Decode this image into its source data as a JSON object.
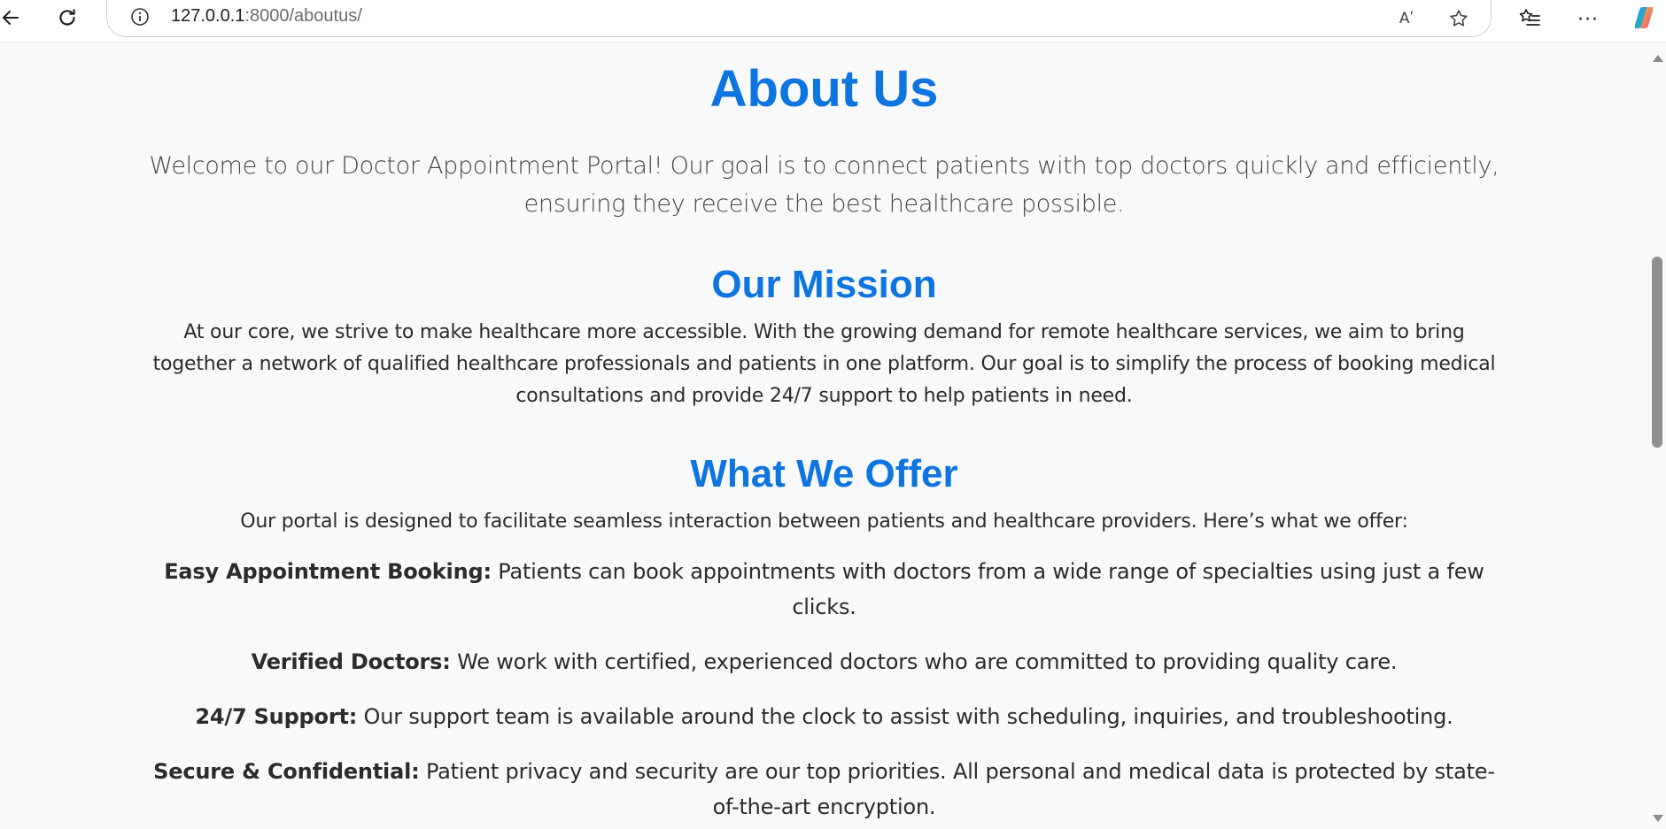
{
  "browser": {
    "url_host": "127.0.0.1",
    "url_rest": ":8000/aboutus/",
    "read_aloud_label": "Aʹ",
    "more_label": "···"
  },
  "page": {
    "title": "About Us",
    "lead": "Welcome to our Doctor Appointment Portal! Our goal is to connect patients with top doctors quickly and efficiently, ensuring they receive the best healthcare possible.",
    "mission": {
      "heading": "Our Mission",
      "text": "At our core, we strive to make healthcare more accessible. With the growing demand for remote healthcare services, we aim to bring together a network of qualified healthcare professionals and patients in one platform. Our goal is to simplify the process of booking medical consultations and provide 24/7 support to help patients in need."
    },
    "offer": {
      "heading": "What We Offer",
      "intro": "Our portal is designed to facilitate seamless interaction between patients and healthcare providers. Here’s what we offer:",
      "features": [
        {
          "label": "Easy Appointment Booking:",
          "text": " Patients can book appointments with doctors from a wide range of specialties using just a few clicks."
        },
        {
          "label": "Verified Doctors:",
          "text": " We work with certified, experienced doctors who are committed to providing quality care."
        },
        {
          "label": "24/7 Support:",
          "text": " Our support team is available around the clock to assist with scheduling, inquiries, and troubleshooting."
        },
        {
          "label": "Secure & Confidential:",
          "text": " Patient privacy and security are our top priorities. All personal and medical data is protected by state-of-the-art encryption."
        }
      ]
    }
  },
  "colors": {
    "heading": "#0d74e0",
    "body_text": "#2b2b2b",
    "background": "#f8f9fb"
  },
  "icons": [
    "back-arrow-icon",
    "reload-icon",
    "info-icon",
    "read-aloud-icon",
    "star-icon",
    "favorites-icon",
    "more-icon",
    "copilot-icon"
  ]
}
